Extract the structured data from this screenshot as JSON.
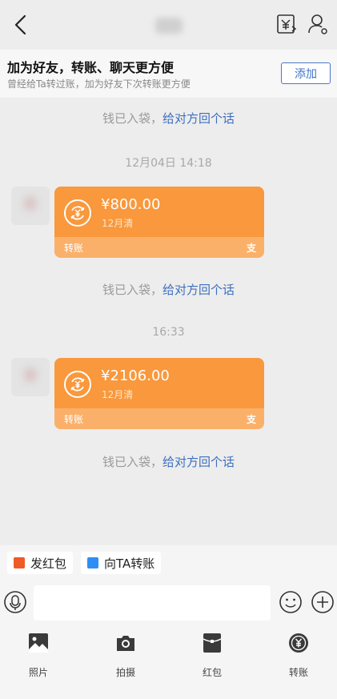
{
  "header": {
    "back_icon": "chevron-left-icon",
    "transfer_icon": "yen-transfer-icon",
    "profile_icon": "user-icon"
  },
  "banner": {
    "title": "加为好友，转账、聊天更方便",
    "subtitle": "曾经给Ta转过账，加为好友下次转账更方便",
    "add_label": "添加"
  },
  "notices": {
    "received_text": "钱已入袋，",
    "reply_link": "给对方回个话"
  },
  "timestamps": [
    "12月04日 14:18",
    "16:33"
  ],
  "transfers": [
    {
      "amount": "¥800.00",
      "note": "12月清",
      "type_label": "转账",
      "brand_glyph": "支"
    },
    {
      "amount": "¥2106.00",
      "note": "12月清",
      "type_label": "转账",
      "brand_glyph": "支"
    }
  ],
  "quick_actions": {
    "red_packet": "发红包",
    "transfer_to_ta": "向TA转账"
  },
  "actions": [
    {
      "label": "照片",
      "icon": "image-icon"
    },
    {
      "label": "拍摄",
      "icon": "camera-icon"
    },
    {
      "label": "红包",
      "icon": "red-packet-icon"
    },
    {
      "label": "转账",
      "icon": "yen-coin-icon"
    }
  ],
  "colors": {
    "accent_blue": "#3d6fbf",
    "card_orange": "#f9983c",
    "card_footer": "#fbb069",
    "red_packet": "#f05a28",
    "transfer_blue": "#2f8ef5"
  }
}
